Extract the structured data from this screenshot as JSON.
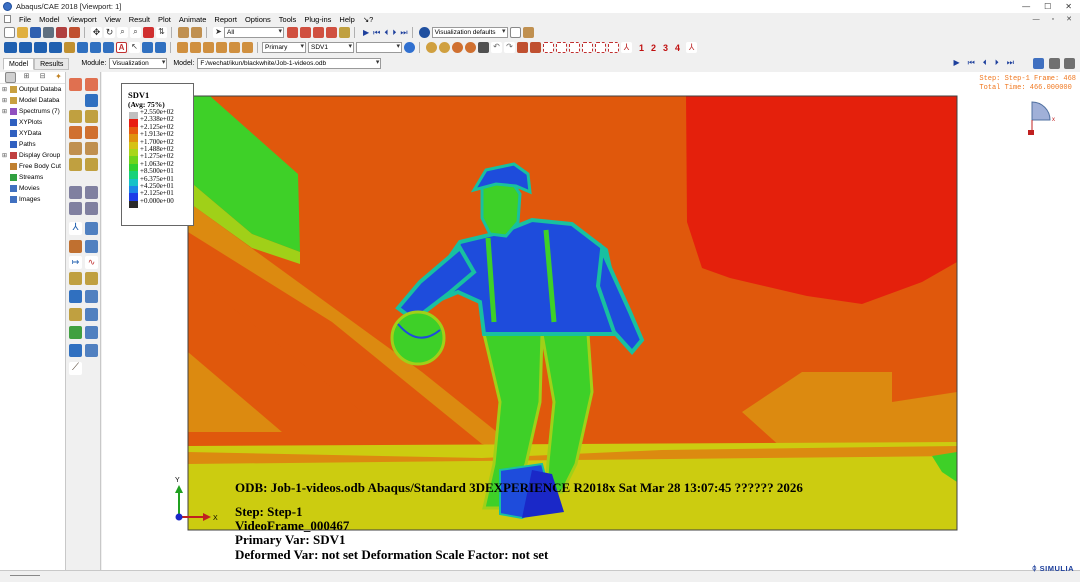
{
  "window": {
    "title": "Abaqus/CAE 2018 [Viewport: 1]",
    "controls": {
      "minimize": "—",
      "maximize": "☐",
      "close": "✕"
    }
  },
  "menu": [
    "File",
    "Model",
    "Viewport",
    "View",
    "Result",
    "Plot",
    "Animate",
    "Report",
    "Options",
    "Tools",
    "Plug-ins",
    "Help",
    "↘?"
  ],
  "mdi_controls": {
    "minimize": "—",
    "restore": "▫",
    "close": "✕"
  },
  "toolbar": {
    "selection_filter": "All",
    "visualization_defaults": "Visualization defaults",
    "output_type": "Primary",
    "variable": "SDV1",
    "component": "",
    "layer_numbers": [
      "1",
      "2",
      "3",
      "4"
    ]
  },
  "module_line": {
    "tabs": [
      "Model",
      "Results"
    ],
    "module_label": "Module:",
    "module_value": "Visualization",
    "model_label": "Model:",
    "model_value": "F:/wechat/ikun/blackwhite/Job-1-videos.odb"
  },
  "results_tree": [
    {
      "label": "Output Databa",
      "expand": "⊞",
      "icon": "database-icon",
      "color": "#c8a040"
    },
    {
      "label": "Model Databa",
      "expand": "⊞",
      "icon": "database-icon",
      "color": "#c8a040"
    },
    {
      "label": "Spectrums (7)",
      "expand": "⊞",
      "icon": "spectrum-icon",
      "color": "#9050c0"
    },
    {
      "label": "XYPlots",
      "expand": "",
      "icon": "xyplot-icon",
      "color": "#3060c0"
    },
    {
      "label": "XYData",
      "expand": "",
      "icon": "xydata-icon",
      "color": "#3060c0"
    },
    {
      "label": "Paths",
      "expand": "",
      "icon": "path-icon",
      "color": "#3060c0"
    },
    {
      "label": "Display Group",
      "expand": "⊞",
      "icon": "display-group-icon",
      "color": "#c04040"
    },
    {
      "label": "Free Body Cut",
      "expand": "",
      "icon": "free-body-icon",
      "color": "#c08030"
    },
    {
      "label": "Streams",
      "expand": "",
      "icon": "streams-icon",
      "color": "#30a040"
    },
    {
      "label": "Movies",
      "expand": "",
      "icon": "movies-icon",
      "color": "#4070c0"
    },
    {
      "label": "Images",
      "expand": "",
      "icon": "images-icon",
      "color": "#4070c0"
    }
  ],
  "legend": {
    "title": "SDV1",
    "subtitle": "(Avg: 75%)",
    "entries": [
      {
        "label": "+2.550e+02",
        "color": "#c0c0c0"
      },
      {
        "label": "+2.338e+02",
        "color": "#e81c10"
      },
      {
        "label": "+2.125e+02",
        "color": "#e65a0e"
      },
      {
        "label": "+1.913e+02",
        "color": "#e0920e"
      },
      {
        "label": "+1.700e+02",
        "color": "#d6c214"
      },
      {
        "label": "+1.488e+02",
        "color": "#a8d61a"
      },
      {
        "label": "+1.275e+02",
        "color": "#6ed41c"
      },
      {
        "label": "+1.063e+02",
        "color": "#30d030"
      },
      {
        "label": "+8.500e+01",
        "color": "#18d27a"
      },
      {
        "label": "+6.375e+01",
        "color": "#14c2c8"
      },
      {
        "label": "+4.250e+01",
        "color": "#1a86e8"
      },
      {
        "label": "+2.125e+01",
        "color": "#1c3ce8"
      },
      {
        "label": "+0.000e+00",
        "color": "#2a2a2a"
      }
    ]
  },
  "step_info": {
    "line1": "Step: Step-1    Frame: 468",
    "line2": "Total Time: 466.000000"
  },
  "overlay": {
    "odb_line": "ODB: Job-1-videos.odb    Abaqus/Standard 3DEXPERIENCE R2018x    Sat Mar 28 13:07:45 ?????? 2026",
    "step_line": "Step: Step-1",
    "frame_line": "VideoFrame_000467",
    "primary_line": "Primary Var: SDV1",
    "deformed_line": "Deformed Var: not set   Deformation Scale Factor: not set"
  },
  "triad": {
    "x": "X",
    "y": "Y"
  },
  "small_triad": {
    "x": "x"
  },
  "brand": "SIMULIA",
  "colors": {
    "red": "#e4200c",
    "orange": "#e0580c",
    "amber": "#dc8a10",
    "yellow": "#cccc10",
    "lime": "#a0d018",
    "green": "#3ed028",
    "teal": "#18c0a0",
    "blue": "#1e4cdc",
    "darkblue": "#1a28c8"
  }
}
